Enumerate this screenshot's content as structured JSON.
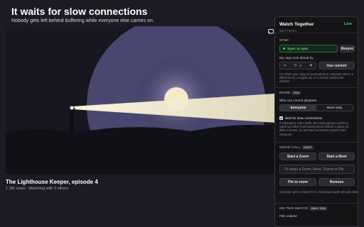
{
  "page": {
    "headline": "It waits for slow connections",
    "subhead": "Nobody gets left behind buffering while everyone else carries on."
  },
  "video": {
    "title": "The Lighthouse Keeper, episode 4",
    "meta": "1.2M views · Watching with 3 others"
  },
  "panel": {
    "title": "Watch Together",
    "live": "Live",
    "cut_section": "SETTINGS",
    "sync": {
      "label": "SYNC",
      "status": "Sync: in sync",
      "resync": "Resync",
      "ahead_label": "My copy runs ahead by",
      "minus": "−",
      "value": "0",
      "unit": "s",
      "plus": "+",
      "use_current": "Use current",
      "help": "For when your copy is not identical to everyone else's: a different cut, a region ad, or a version without the adverts."
    },
    "room": {
      "label": "ROOM",
      "tag": "YOU",
      "control_label": "Who can control playback",
      "option_everyone": "Everyone",
      "option_host": "Host only",
      "wait_label": "Wait for slow connections",
      "wait_help": "If someone's video stalls, the room pauses until they catch up rather than leaving them behind. It gives up after a minute, so one bad connection doesn't hold everyone."
    },
    "voice": {
      "label": "VOICE CALL",
      "tag": "HOST",
      "zoom": "Start a Zoom",
      "meet": "Start a Meet",
      "paste_placeholder": "Or paste a Zoom, Meet, Teams or Dis",
      "pin": "Pin to room",
      "remove": "Remove",
      "help": "Everyone gets a button for it, including people who join later."
    },
    "device": {
      "label": "ON THIS DEVICE",
      "tag": "ONLY YOU",
      "volume_label": "Film volume"
    }
  },
  "colors": {
    "live": "#45d26a",
    "sync_text": "#6be08a",
    "beam": "#f3ead0",
    "sky": "#4b4773"
  },
  "icons": {
    "cast": "cast-icon",
    "sync_status": "status-dot-icon",
    "checkbox": "checkbox-checked-icon"
  }
}
